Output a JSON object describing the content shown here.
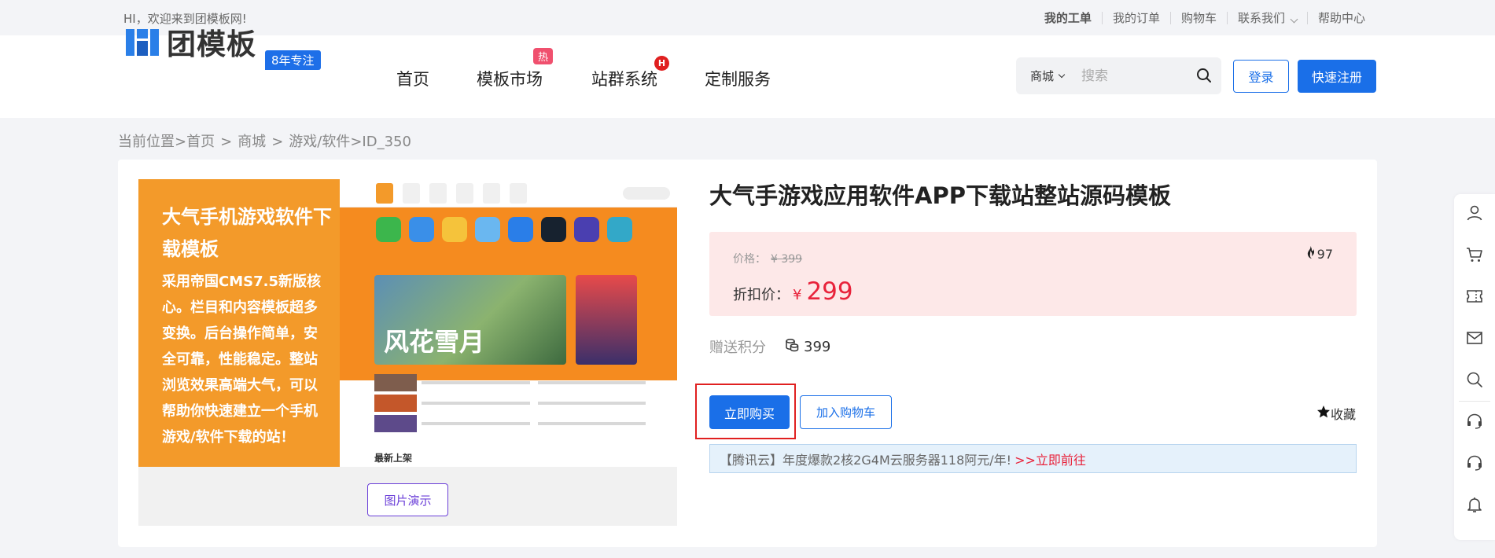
{
  "topbar": {
    "welcome": "HI，欢迎来到团模板网!",
    "links": [
      "我的工单",
      "我的订单",
      "购物车",
      "联系我们",
      "帮助中心"
    ]
  },
  "header": {
    "logo_text": "团模板",
    "logo_badge": "8年专注",
    "nav": [
      {
        "label": "首页"
      },
      {
        "label": "模板市场",
        "badge": "热"
      },
      {
        "label": "站群系统",
        "badge": "H"
      },
      {
        "label": "定制服务"
      }
    ],
    "search": {
      "scope": "商城",
      "placeholder": "搜索"
    },
    "login": "登录",
    "register": "快速注册"
  },
  "breadcrumb": {
    "prefix": "当前位置>",
    "items": [
      "首页",
      "商城",
      "游戏/软件>ID_350"
    ],
    "separator": ">"
  },
  "preview": {
    "headline": "大气手机游戏软件下载模板",
    "description": "采用帝国CMS7.5新版核心。栏目和内容模板超多变换。后台操作简单，安全可靠，性能稳定。整站浏览效果高端大气，可以帮助你快速建立一个手机游戏/软件下载的站！",
    "hero_text": "风花雪月",
    "new_label": "最新上架",
    "button": "图片演示"
  },
  "product": {
    "title": "大气手游戏应用软件APP下载站整站源码模板",
    "price_label": "价格：",
    "price_original": "¥ 399",
    "discount_label": "折扣价：",
    "currency": "¥",
    "discount_price": "299",
    "heat": "97",
    "points_label": "赠送积分",
    "points_value": "399",
    "buy": "立即购买",
    "add_cart": "加入购物车",
    "favorite": "收藏",
    "ad_text": "【腾讯云】年度爆款2核2G4M云服务器118阿元/年!",
    "ad_link": ">>立即前往"
  },
  "colors": {
    "primary": "#1a6fe8",
    "price_red": "#e8233b",
    "price_bg": "#fde8e8",
    "banner_orange": "#f39a2a",
    "highlight": "#e02020"
  },
  "sidebar_icons": [
    "user-icon",
    "cart-icon",
    "ticket-icon",
    "mail-icon",
    "search-icon",
    "headset-icon",
    "headset-icon",
    "bell-icon"
  ]
}
